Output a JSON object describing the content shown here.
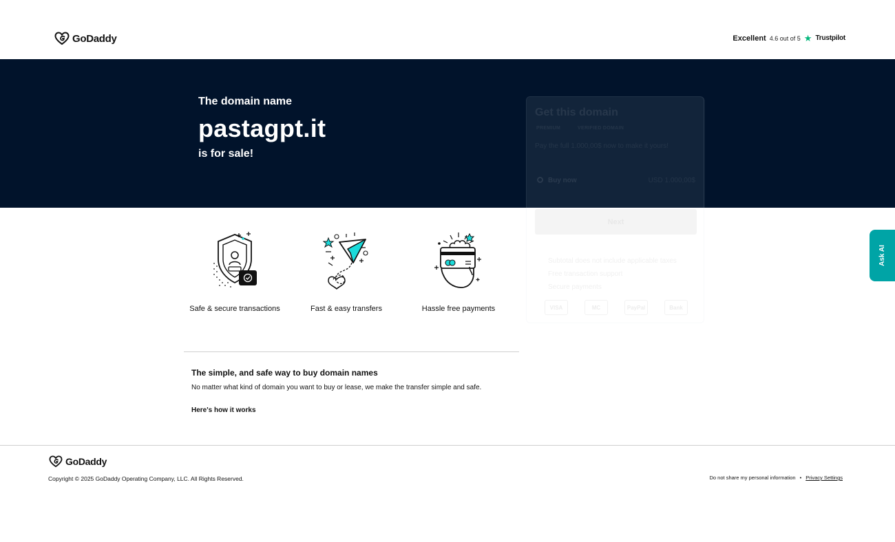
{
  "header": {
    "logo_text": "GoDaddy",
    "trustpilot": {
      "label": "Excellent",
      "rating": "4.6 out of 5",
      "brand": "Trustpilot"
    }
  },
  "hero": {
    "pre": "The domain name",
    "domain": "pastagpt.it",
    "post": "is for sale!"
  },
  "card": {
    "title": "Get this domain",
    "badges": [
      "PREMIUM",
      "VERIFIED DOMAIN"
    ],
    "description": "Pay the full 1.000,00$ now to make it yours!",
    "option_label": "Buy now",
    "option_price": "USD 1.000,00$",
    "next_label": "Next",
    "bullets": [
      "Subtotal does not include applicable taxes",
      "Free transaction support",
      "Secure payments"
    ],
    "payment_icons": [
      "VISA",
      "MC",
      "PayPal",
      "Bank"
    ]
  },
  "features": [
    {
      "label": "Safe & secure transactions",
      "icon": "shield-lock-icon"
    },
    {
      "label": "Fast & easy transfers",
      "icon": "paper-plane-icon"
    },
    {
      "label": "Hassle free payments",
      "icon": "hand-card-icon"
    }
  ],
  "info": {
    "title": "The simple, and safe way to buy domain names",
    "description": "No matter what kind of domain you want to buy or lease, we make the transfer simple and safe.",
    "link": "Here's how it works"
  },
  "footer": {
    "logo_text": "GoDaddy",
    "copyright": "Copyright © 2025 GoDaddy Operating Company, LLC. All Rights Reserved.",
    "links": [
      "Do not share my personal information",
      "Privacy Settings"
    ],
    "separator": "•"
  },
  "ask_ai": {
    "label": "Ask AI",
    "color": "#00a4a6"
  },
  "colors": {
    "hero_bg": "#01132b",
    "accent_teal": "#1bdbdb",
    "trustpilot_green": "#00b67a"
  }
}
